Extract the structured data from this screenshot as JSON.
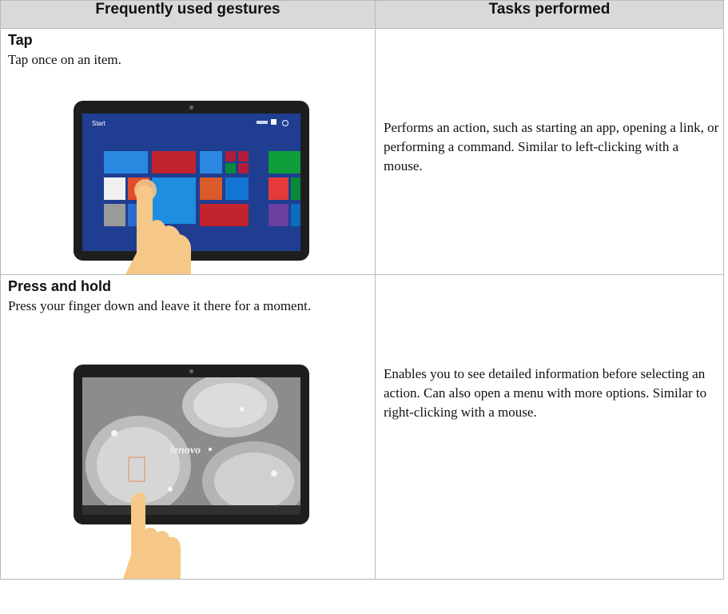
{
  "header": {
    "left": "Frequently used gestures",
    "right": "Tasks performed"
  },
  "gestures": [
    {
      "title": "Tap",
      "description": "Tap once on an item.",
      "task": "Performs an action, such as starting an app, opening a link, or performing a command. Similar to left-clicking with a mouse.",
      "screen_label": "Start"
    },
    {
      "title": "Press and hold",
      "description": "Press your finger down and leave it there for a moment.",
      "task": "Enables you to see detailed information before selecting an action. Can also open a menu with more options. Similar to right-clicking with a mouse.",
      "brand_text": "lenovo"
    }
  ],
  "colors": {
    "header_bg": "#d9d9d9",
    "border": "#b9b9b9",
    "start_screen_bg": "#1f3e91",
    "finger": "#f6c888"
  }
}
